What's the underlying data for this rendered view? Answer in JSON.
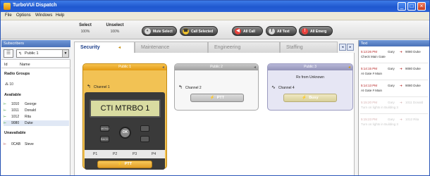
{
  "window": {
    "title": "TurboVUi Dispatch"
  },
  "menu": [
    "File",
    "Options",
    "Windows",
    "Help"
  ],
  "toolbar": {
    "select_label": "Select",
    "select_pct": "100%",
    "unselect_label": "Unselect",
    "unselect_pct": "100%",
    "buttons": [
      "Mute Select",
      "Call Selected",
      "All Call",
      "All Text",
      "All Emerg"
    ]
  },
  "subscribers": {
    "header": "Subscribers",
    "combo_value": "Public 1",
    "columns": [
      "Id",
      "Name"
    ],
    "radio_groups_label": "Radio Groups",
    "radio_group_item": "10",
    "available_label": "Available",
    "available": [
      {
        "id": "1010",
        "name": "George"
      },
      {
        "id": "1011",
        "name": "Donald"
      },
      {
        "id": "1012",
        "name": "Rita"
      },
      {
        "id": "9080",
        "name": "Duke"
      }
    ],
    "unavailable_label": "Unavailable",
    "unavailable": [
      {
        "id": "0CAB",
        "name": "Steve"
      }
    ]
  },
  "tabs": [
    "Security",
    "Maintenance",
    "Engineering",
    "Staffing"
  ],
  "channels": [
    {
      "header": "Public 1",
      "channel": "Channel 1",
      "lcd": "CTI MTRBO 1",
      "keys": [
        "MENU",
        "BACK",
        "OK"
      ],
      "prog_keys": [
        "P1",
        "P2",
        "P3",
        "P4"
      ],
      "ptt": "PTT"
    },
    {
      "header": "Public 2",
      "channel": "Channel 2",
      "ptt": "PTT"
    },
    {
      "header": "Public 3",
      "status": "Rx from Unknown",
      "channel": "Channel 4",
      "ptt": "Busy"
    }
  ],
  "text_panel": {
    "header": "Text",
    "messages": [
      {
        "time": "5:13:26 PM",
        "user": "Gary",
        "dest": "9080 Duke",
        "body": "Check Main Gate",
        "faded": false
      },
      {
        "time": "5:14:15 PM",
        "user": "Gary",
        "dest": "9080 Duke",
        "body": "At Gate # Main",
        "faded": false
      },
      {
        "time": "5:14:13 PM",
        "user": "Gary",
        "dest": "9080 Duke",
        "body": "At Gate # Main",
        "faded": false
      },
      {
        "time": "5:15:20 PM",
        "user": "Gary",
        "dest": "1011 Donald",
        "body": "Turn on lights in Building 3",
        "faded": true
      },
      {
        "time": "5:15:23 PM",
        "user": "Gary",
        "dest": "1012 Rita",
        "body": "Turn on lights in Building 3",
        "faded": true
      }
    ]
  },
  "colors": {
    "titlebar": "#1f58cf",
    "active_channel": "#f2c254",
    "rx_channel": "#e6e6f4"
  }
}
